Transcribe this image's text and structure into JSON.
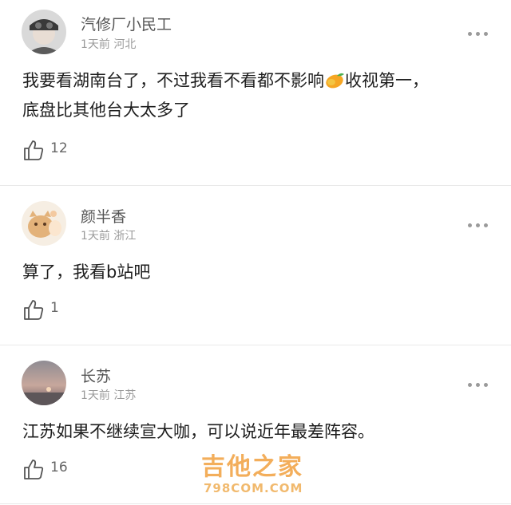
{
  "comments": [
    {
      "name": "汽修厂小民工",
      "time": "1天前",
      "location": "河北",
      "text_line1_a": "我要看湖南台了，不过我看不看都不影响",
      "text_line1_b": "收视第一，",
      "text_line2": "底盘比其他台大太多了",
      "likes": "12",
      "emoji_icon": "mango-icon"
    },
    {
      "name": "颜半香",
      "time": "1天前",
      "location": "浙江",
      "text_line1": "算了，我看b站吧",
      "likes": "1"
    },
    {
      "name": "长苏",
      "time": "1天前",
      "location": "江苏",
      "text_line1": "江苏如果不继续宣大咖，可以说近年最差阵容。",
      "likes": "16"
    }
  ],
  "watermark": {
    "line1": "吉他之家",
    "line2": "798COM.COM"
  },
  "colors": {
    "name": "#555555",
    "meta": "#9a9a9a",
    "text": "#1e1e1e",
    "divider": "#e9e9e9",
    "watermark": "#f2a64a"
  }
}
